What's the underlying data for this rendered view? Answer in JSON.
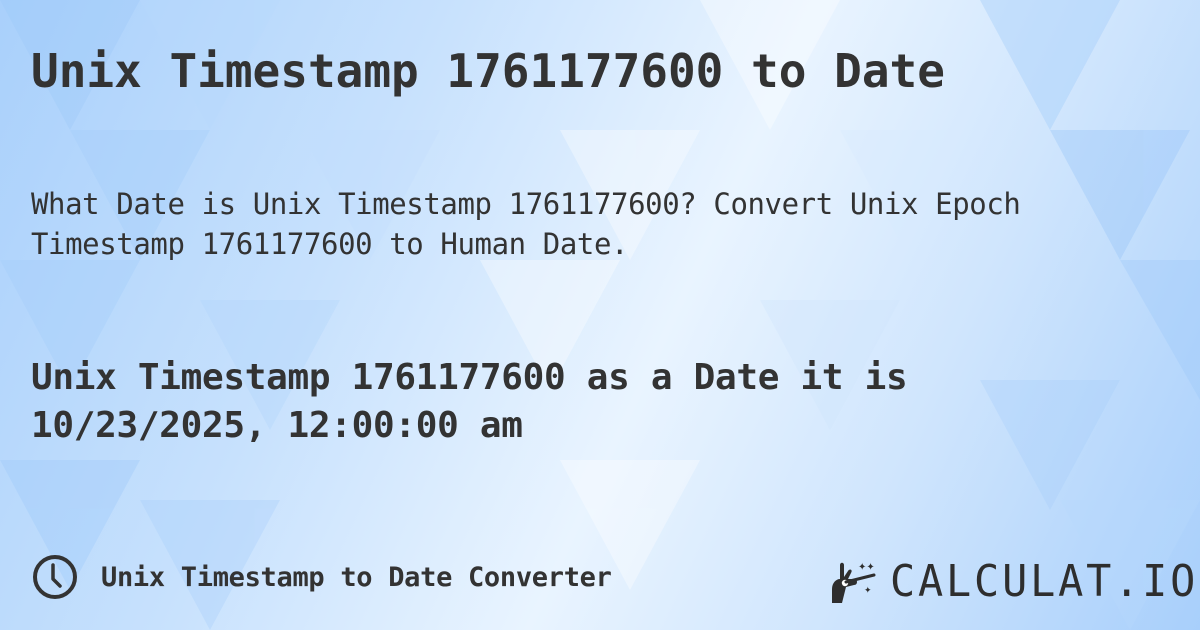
{
  "page": {
    "title": "Unix Timestamp 1761177600 to Date",
    "description": "What Date is Unix Timestamp 1761177600? Convert Unix Epoch Timestamp 1761177600 to Human Date.",
    "result_line1": "Unix Timestamp 1761177600 as a Date it is",
    "result_line2": "10/23/2025, 12:00:00 am"
  },
  "footer": {
    "icon": "clock-icon",
    "link_label": "Unix Timestamp to Date Converter"
  },
  "brand": {
    "logo_icon": "magic-wand-hand-icon",
    "name": "CALCULAT.IO"
  },
  "colors": {
    "text": "#333333",
    "background_light": "#e9f4ff",
    "background_blue": "#a9d0fb"
  }
}
